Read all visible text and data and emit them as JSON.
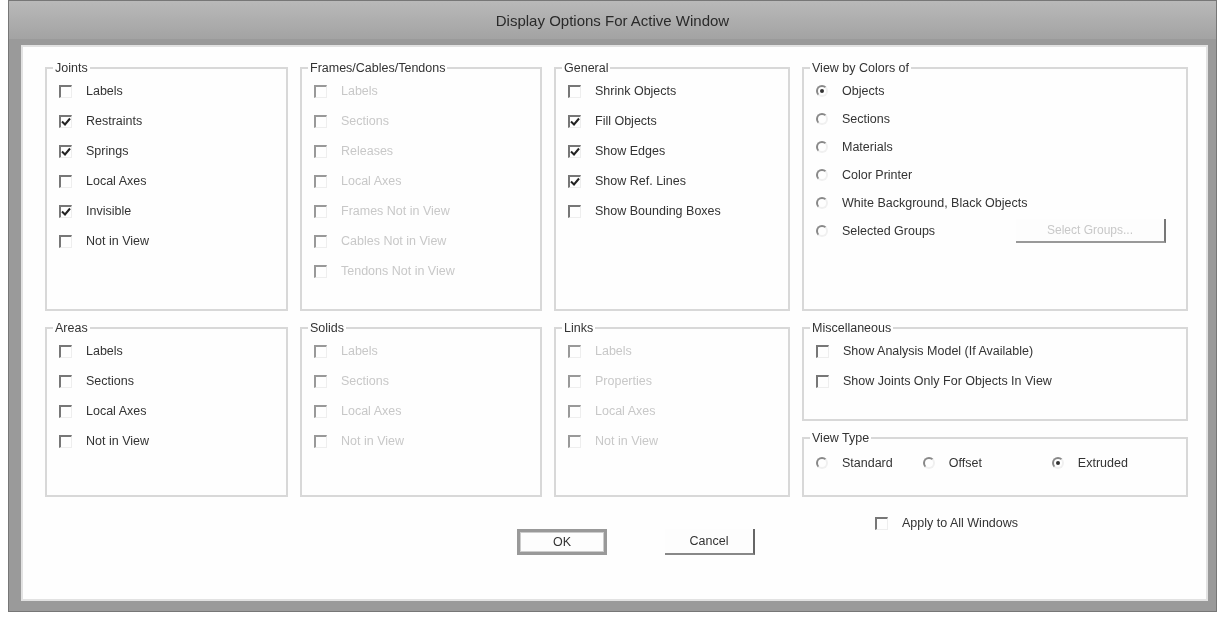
{
  "window": {
    "title": "Display Options For Active Window"
  },
  "groups": [
    {
      "title": "Joints",
      "kind": "checkboxes",
      "items": [
        {
          "label": "Labels",
          "checked": false,
          "disabled": false
        },
        {
          "label": "Restraints",
          "checked": true,
          "disabled": false
        },
        {
          "label": "Springs",
          "checked": true,
          "disabled": false
        },
        {
          "label": "Local Axes",
          "checked": false,
          "disabled": false
        },
        {
          "label": "Invisible",
          "checked": true,
          "disabled": false
        },
        {
          "label": "Not in View",
          "checked": false,
          "disabled": false
        }
      ]
    },
    {
      "title": "Frames/Cables/Tendons",
      "kind": "checkboxes",
      "items": [
        {
          "label": "Labels",
          "checked": false,
          "disabled": true
        },
        {
          "label": "Sections",
          "checked": false,
          "disabled": true
        },
        {
          "label": "Releases",
          "checked": false,
          "disabled": true
        },
        {
          "label": "Local Axes",
          "checked": false,
          "disabled": true
        },
        {
          "label": "Frames Not in View",
          "checked": false,
          "disabled": true
        },
        {
          "label": "Cables Not in View",
          "checked": false,
          "disabled": true
        },
        {
          "label": "Tendons Not in View",
          "checked": false,
          "disabled": true
        }
      ]
    },
    {
      "title": "General",
      "kind": "checkboxes",
      "items": [
        {
          "label": "Shrink Objects",
          "checked": false,
          "disabled": false
        },
        {
          "label": "Fill Objects",
          "checked": true,
          "disabled": false
        },
        {
          "label": "Show Edges",
          "checked": true,
          "disabled": false
        },
        {
          "label": "Show Ref. Lines",
          "checked": true,
          "disabled": false
        },
        {
          "label": "Show Bounding Boxes",
          "checked": false,
          "disabled": false
        }
      ]
    },
    {
      "title": "View by Colors of",
      "kind": "radios",
      "items": [
        {
          "label": "Objects",
          "selected": true
        },
        {
          "label": "Sections",
          "selected": false
        },
        {
          "label": "Materials",
          "selected": false
        },
        {
          "label": "Color Printer",
          "selected": false
        },
        {
          "label": "White Background, Black Objects",
          "selected": false
        },
        {
          "label": "Selected Groups",
          "selected": false,
          "button": {
            "label": "Select Groups...",
            "disabled": true
          }
        }
      ]
    },
    {
      "title": "Areas",
      "kind": "checkboxes",
      "items": [
        {
          "label": "Labels",
          "checked": false,
          "disabled": false
        },
        {
          "label": "Sections",
          "checked": false,
          "disabled": false
        },
        {
          "label": "Local Axes",
          "checked": false,
          "disabled": false
        },
        {
          "label": "Not in View",
          "checked": false,
          "disabled": false
        }
      ]
    },
    {
      "title": "Solids",
      "kind": "checkboxes",
      "items": [
        {
          "label": "Labels",
          "checked": false,
          "disabled": true
        },
        {
          "label": "Sections",
          "checked": false,
          "disabled": true
        },
        {
          "label": "Local Axes",
          "checked": false,
          "disabled": true
        },
        {
          "label": "Not in View",
          "checked": false,
          "disabled": true
        }
      ]
    },
    {
      "title": "Links",
      "kind": "checkboxes",
      "items": [
        {
          "label": "Labels",
          "checked": false,
          "disabled": true
        },
        {
          "label": "Properties",
          "checked": false,
          "disabled": true
        },
        {
          "label": "Local Axes",
          "checked": false,
          "disabled": true
        },
        {
          "label": "Not in View",
          "checked": false,
          "disabled": true
        }
      ]
    },
    {
      "title": "Miscellaneous",
      "kind": "checkboxes",
      "items": [
        {
          "label": "Show Analysis Model  (If Available)",
          "checked": false,
          "disabled": false
        },
        {
          "label": "Show Joints Only For Objects In View",
          "checked": false,
          "disabled": false
        }
      ]
    },
    {
      "title": "View Type",
      "kind": "radio_row",
      "items": [
        {
          "label": "Standard",
          "selected": false
        },
        {
          "label": "Offset",
          "selected": false
        },
        {
          "label": "Extruded",
          "selected": true
        }
      ]
    }
  ],
  "apply_all": {
    "label": "Apply to All Windows",
    "checked": false
  },
  "buttons": [
    {
      "label": "OK",
      "default": true
    },
    {
      "label": "Cancel",
      "default": false
    }
  ]
}
